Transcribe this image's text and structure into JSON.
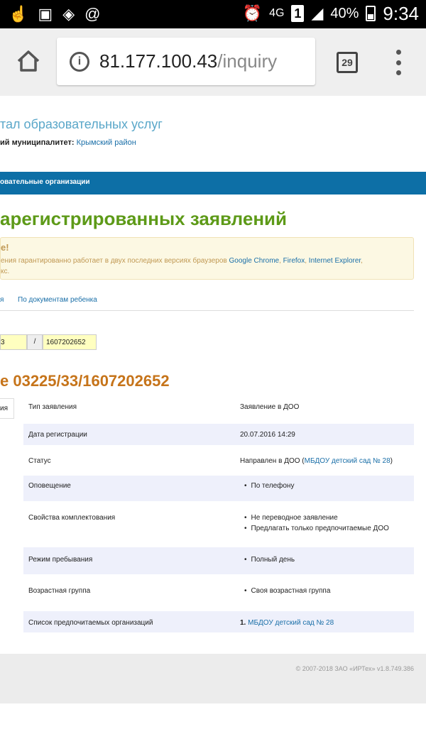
{
  "status_bar": {
    "icons_left": [
      "footprint-icon",
      "image-icon",
      "wifi-icon",
      "at-icon"
    ],
    "network": "4G",
    "sim": "1",
    "battery": "40%",
    "time": "9:34"
  },
  "browser": {
    "url_host": "81.177.100.43",
    "url_path": "/inquiry",
    "tab_count": "29"
  },
  "site": {
    "portal_title": "тал образовательных услуг",
    "municipality_label": "ий муниципалитет:",
    "municipality_value": "Крымский район",
    "nav_item": "овательные организации"
  },
  "main": {
    "heading": "арегистрированных заявлений",
    "warning_title": "е!",
    "warning_text_1": "ения гарантированно работает в двух последних версиях браузеров ",
    "warning_browser_1": "Google Chrome",
    "warning_sep_1": ", ",
    "warning_browser_2": "Firefox",
    "warning_sep_2": ", ",
    "warning_browser_3": "Internet Explorer",
    "warning_sep_3": ",",
    "warning_text_2": "кс.",
    "tab_prev": "я",
    "tab_docs": "По документам ребенка",
    "search_field_1": "3",
    "search_slash": "/",
    "search_field_2": "1607202652",
    "result_heading": "е 03225/33/1607202652",
    "side_tab": "ия"
  },
  "details": {
    "type_label": "Тип заявления",
    "type_value": "Заявление в ДОО",
    "reg_date_label": "Дата регистрации",
    "reg_date_value": "20.07.2016 14:29",
    "status_label": "Статус",
    "status_value_prefix": "Направлен в ДОО (",
    "status_value_link": "МБДОУ детский сад № 28",
    "status_value_suffix": ")",
    "notify_label": "Оповещение",
    "notify_value": "По телефону",
    "props_label": "Свойства комплектования",
    "props_value_1": "Не переводное заявление",
    "props_value_2": "Предлагать только предпочитаемые ДОО",
    "mode_label": "Режим пребывания",
    "mode_value": "Полный день",
    "age_label": "Возрастная группа",
    "age_value": "Своя возрастная группа",
    "orgs_label": "Список предпочитаемых организаций",
    "orgs_num": "1.",
    "orgs_value": "МБДОУ детский сад № 28"
  },
  "footer": {
    "copyright": "© 2007-2018 ЗАО «ИРТех» v1.8.749.386"
  }
}
